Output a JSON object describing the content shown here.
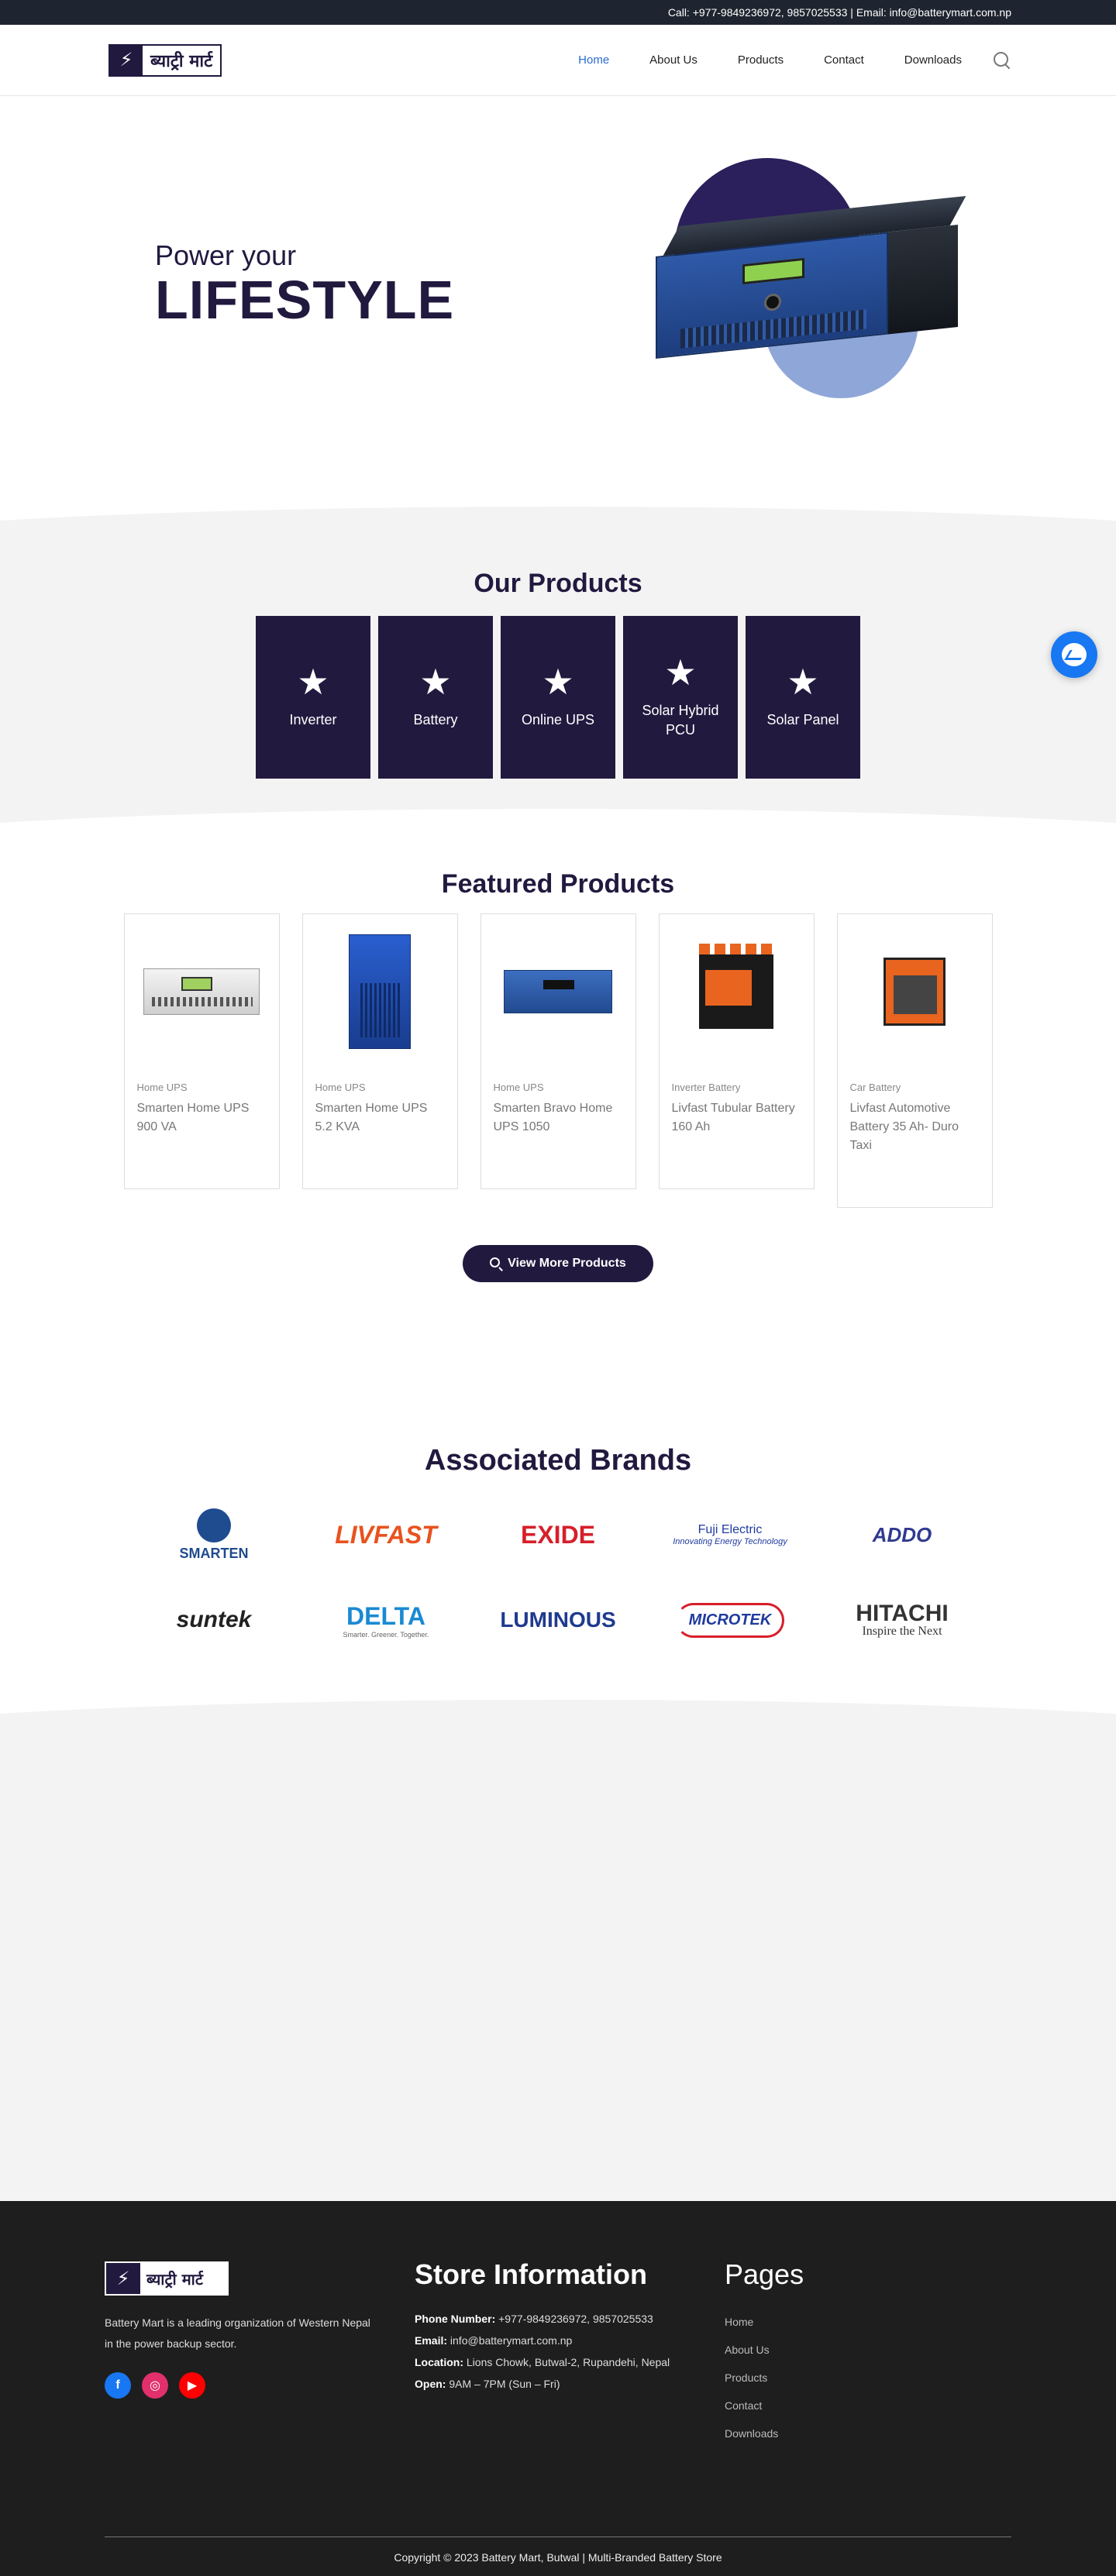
{
  "topbar": {
    "contact": "Call: +977-9849236972, 9857025533 | Email: info@batterymart.com.np"
  },
  "header": {
    "logo_text": "ब्याट्री मार्ट",
    "nav": [
      {
        "label": "Home",
        "active": true
      },
      {
        "label": "About Us",
        "active": false
      },
      {
        "label": "Products",
        "active": false
      },
      {
        "label": "Contact",
        "active": false
      },
      {
        "label": "Downloads",
        "active": false
      }
    ],
    "search_icon": "search-icon"
  },
  "hero": {
    "line1": "Power your",
    "line2": "LIFESTYLE"
  },
  "our_products": {
    "title": "Our Products",
    "categories": [
      {
        "label": "Inverter",
        "icon": "star-icon"
      },
      {
        "label": "Battery",
        "icon": "star-icon"
      },
      {
        "label": "Online UPS",
        "icon": "star-icon"
      },
      {
        "label": "Solar Hybrid PCU",
        "icon": "star-icon"
      },
      {
        "label": "Solar Panel",
        "icon": "star-icon"
      }
    ]
  },
  "featured": {
    "title": "Featured Products",
    "products": [
      {
        "category": "Home UPS",
        "name": "Smarten Home UPS 900 VA"
      },
      {
        "category": "Home UPS",
        "name": "Smarten Home UPS 5.2 KVA"
      },
      {
        "category": "Home UPS",
        "name": "Smarten Bravo Home UPS 1050"
      },
      {
        "category": "Inverter Battery",
        "name": "Livfast Tubular Battery 160 Ah"
      },
      {
        "category": "Car Battery",
        "name": "Livfast Automotive Battery 35 Ah- Duro Taxi"
      }
    ],
    "view_more_label": "View More Products"
  },
  "brands": {
    "title": "Associated Brands",
    "items": [
      {
        "name": "SMARTEN"
      },
      {
        "name": "LIVFAST"
      },
      {
        "name": "EXIDE"
      },
      {
        "name": "Fuji Electric"
      },
      {
        "name": "ADDO"
      },
      {
        "name": "suntek"
      },
      {
        "name": "DELTA"
      },
      {
        "name": "LUMINOUS"
      },
      {
        "name": "MICROTEK"
      },
      {
        "name": "HITACHI"
      }
    ],
    "fuji_tagline": "Innovating Energy Technology",
    "delta_tagline": "Smarter. Greener. Together.",
    "hitachi_tagline": "Inspire the Next"
  },
  "footer": {
    "logo_text": "ब्याट्री मार्ट",
    "description": "Battery Mart is a leading organization of Western Nepal in the power backup sector.",
    "socials": [
      "facebook-icon",
      "instagram-icon",
      "youtube-icon"
    ],
    "store_title": "Store Information",
    "phone_label": "Phone Number:",
    "phone_value": "+977-9849236972, 9857025533",
    "email_label": "Email:",
    "email_value": "info@batterymart.com.np",
    "location_label": "Location:",
    "location_value": "Lions Chowk, Butwal-2, Rupandehi, Nepal",
    "open_label": "Open:",
    "open_value": "9AM – 7PM (Sun – Fri)",
    "pages_title": "Pages",
    "pages": [
      "Home",
      "About Us",
      "Products",
      "Contact",
      "Downloads"
    ],
    "copyright": "Copyright © 2023 Battery Mart, Butwal | Multi-Branded Battery Store"
  },
  "colors": {
    "primary": "#22193f",
    "accent": "#2a6bd0",
    "footer_bg": "#1e1e1e",
    "section_gray": "#f3f3f3"
  }
}
